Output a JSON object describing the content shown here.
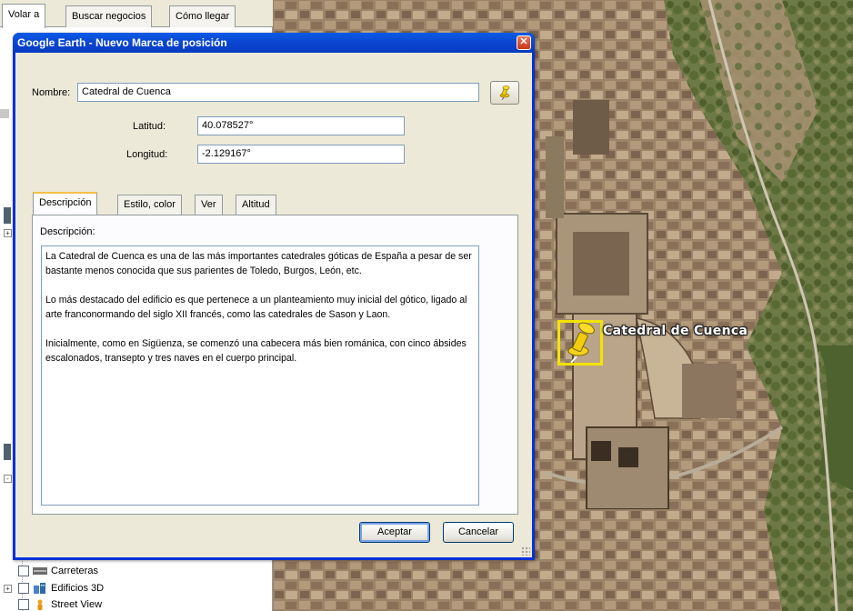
{
  "side_panel": {
    "tabs": [
      {
        "label": "Volar a",
        "active": true
      },
      {
        "label": "Buscar negocios",
        "active": false
      },
      {
        "label": "Cómo llegar",
        "active": false
      }
    ],
    "layers": [
      {
        "label": "Carreteras",
        "icon": "roads-icon"
      },
      {
        "label": "Edificios 3D",
        "icon": "buildings-3d-icon"
      },
      {
        "label": "Street View",
        "icon": "street-view-icon"
      }
    ]
  },
  "map": {
    "placemark_label": "Catedral de Cuenca",
    "highlight_color": "#f3e400"
  },
  "dialog": {
    "title": "Google Earth - Nuevo Marca de posición",
    "name_label": "Nombre:",
    "name_value": "Catedral de Cuenca",
    "latitude_label": "Latitud:",
    "latitude_value": "40.078527°",
    "longitude_label": "Longitud:",
    "longitude_value": "-2.129167°",
    "tabs": [
      {
        "label": "Descripción",
        "active": true
      },
      {
        "label": "Estilo, color",
        "active": false
      },
      {
        "label": "Ver",
        "active": false
      },
      {
        "label": "Altitud",
        "active": false
      }
    ],
    "description_label": "Descripción:",
    "description_paragraphs": [
      "La Catedral de Cuenca es una de las más importantes catedrales góticas de España a pesar de ser bastante menos conocida que sus parientes de Toledo, Burgos, León, etc.",
      "Lo más destacado del edificio es que pertenece a un planteamiento muy inicial del gótico, ligado al arte franconormando del siglo XII francés, como las catedrales de Sason y Laon.",
      "Inicialmente, como en Sigüenza, se comenzó una cabecera más bien románica, con cinco ábsides escalonados, transepto y tres naves en el cuerpo principal."
    ],
    "ok_label": "Aceptar",
    "cancel_label": "Cancelar",
    "title_color": "#0b46d0"
  }
}
